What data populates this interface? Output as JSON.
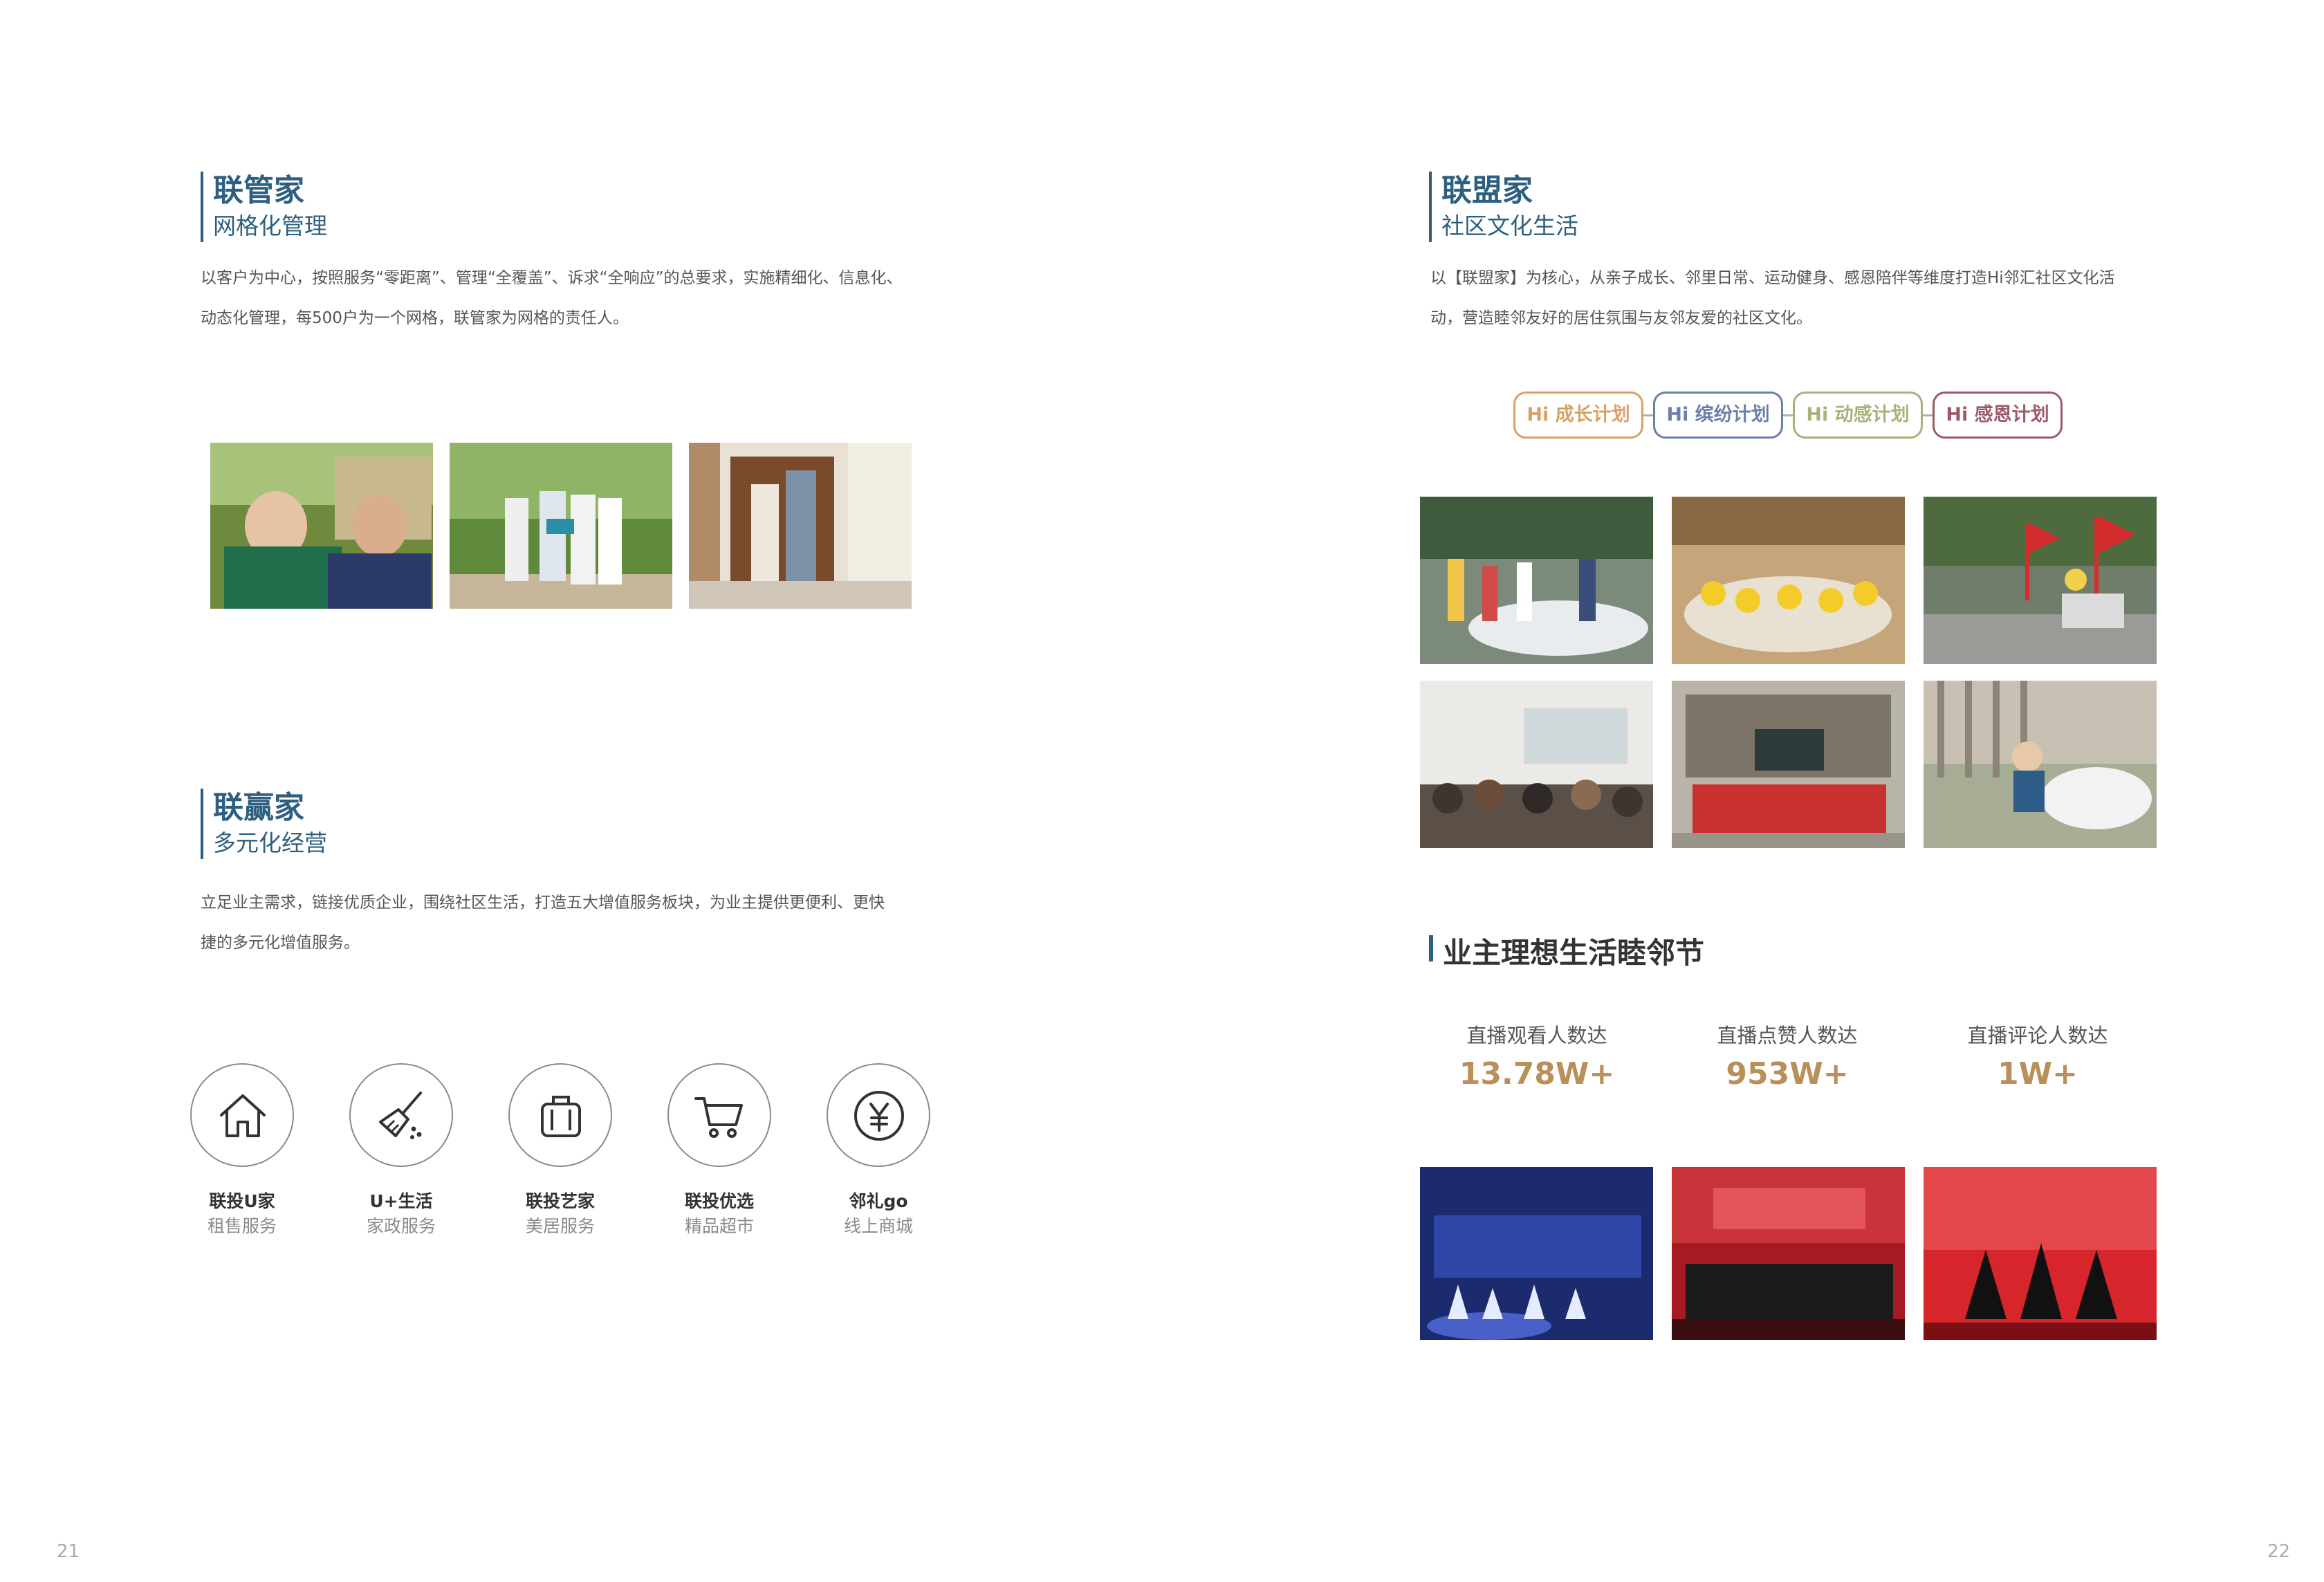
{
  "left": {
    "manager": {
      "title": "联管家",
      "subtitle": "网格化管理",
      "desc_line1": "以客户为中心，按照服务“零距离”、管理“全覆盖”、诉求“全响应”的总要求，实施精细化、信息化、",
      "desc_line2": "动态化管理，每500户为一个网格，联管家为网格的责任人。"
    },
    "winner": {
      "title": "联赢家",
      "subtitle": "多元化经营",
      "desc_line1": "立足业主需求，链接优质企业，围绕社区生活，打造五大增值服务板块，为业主提供更便利、更快",
      "desc_line2": "捷的多元化增值服务。"
    },
    "services": [
      {
        "name": "联投U家",
        "desc": "租售服务",
        "icon": "house-icon"
      },
      {
        "name": "U+生活",
        "desc": "家政服务",
        "icon": "broom-icon"
      },
      {
        "name": "联投艺家",
        "desc": "美居服务",
        "icon": "suitcase-icon"
      },
      {
        "name": "联投优选",
        "desc": "精品超市",
        "icon": "cart-icon"
      },
      {
        "name": "邻礼go",
        "desc": "线上商城",
        "icon": "yen-icon"
      }
    ]
  },
  "right": {
    "alliance": {
      "title": "联盟家",
      "subtitle": "社区文化生活",
      "desc_line1": "以【联盟家】为核心，从亲子成长、邻里日常、运动健身、感恩陪伴等维度打造Hi邻汇社区文化活",
      "desc_line2": "动，营造睦邻友好的居住氛围与友邻友爱的社区文化。"
    },
    "plans": [
      {
        "label": "Hi 成长计划",
        "color": "#d9a066"
      },
      {
        "label": "Hi 缤纷计划",
        "color": "#6b7fa8"
      },
      {
        "label": "Hi 动感计划",
        "color": "#a9b07a"
      },
      {
        "label": "Hi 感恩计划",
        "color": "#9c5a66"
      }
    ],
    "festival": {
      "title": "业主理想生活睦邻节",
      "stats": [
        {
          "label": "直播观看人数达",
          "value": "13.78W+"
        },
        {
          "label": "直播点赞人数达",
          "value": "953W+"
        },
        {
          "label": "直播评论人数达",
          "value": "1W+"
        }
      ]
    }
  },
  "page_numbers": {
    "left": "21",
    "right": "22"
  },
  "colors": {
    "heading": "#2c5f80",
    "stat": "#b9905a"
  }
}
